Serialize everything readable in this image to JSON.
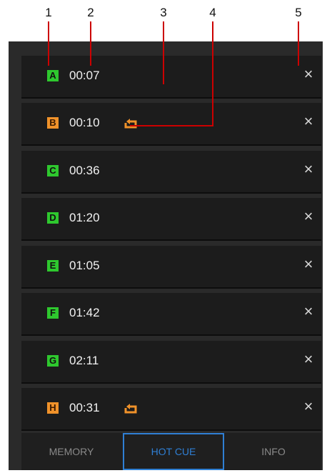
{
  "callouts": [
    "1",
    "2",
    "3",
    "4",
    "5"
  ],
  "cues": [
    {
      "letter": "A",
      "time": "00:07",
      "color": "green",
      "loop": false
    },
    {
      "letter": "B",
      "time": "00:10",
      "color": "orange",
      "loop": true
    },
    {
      "letter": "C",
      "time": "00:36",
      "color": "green",
      "loop": false
    },
    {
      "letter": "D",
      "time": "01:20",
      "color": "green",
      "loop": false
    },
    {
      "letter": "E",
      "time": "01:05",
      "color": "green",
      "loop": false
    },
    {
      "letter": "F",
      "time": "01:42",
      "color": "green",
      "loop": false
    },
    {
      "letter": "G",
      "time": "02:11",
      "color": "green",
      "loop": false
    },
    {
      "letter": "H",
      "time": "00:31",
      "color": "orange",
      "loop": true
    }
  ],
  "close_icon": "×",
  "tabs": [
    {
      "label": "MEMORY",
      "active": false
    },
    {
      "label": "HOT CUE",
      "active": true
    },
    {
      "label": "INFO",
      "active": false
    }
  ],
  "colors": {
    "green": "#2ec82e",
    "orange": "#f0922a",
    "accent_blue": "#2f7fd4",
    "callout_line": "#cc0000"
  }
}
